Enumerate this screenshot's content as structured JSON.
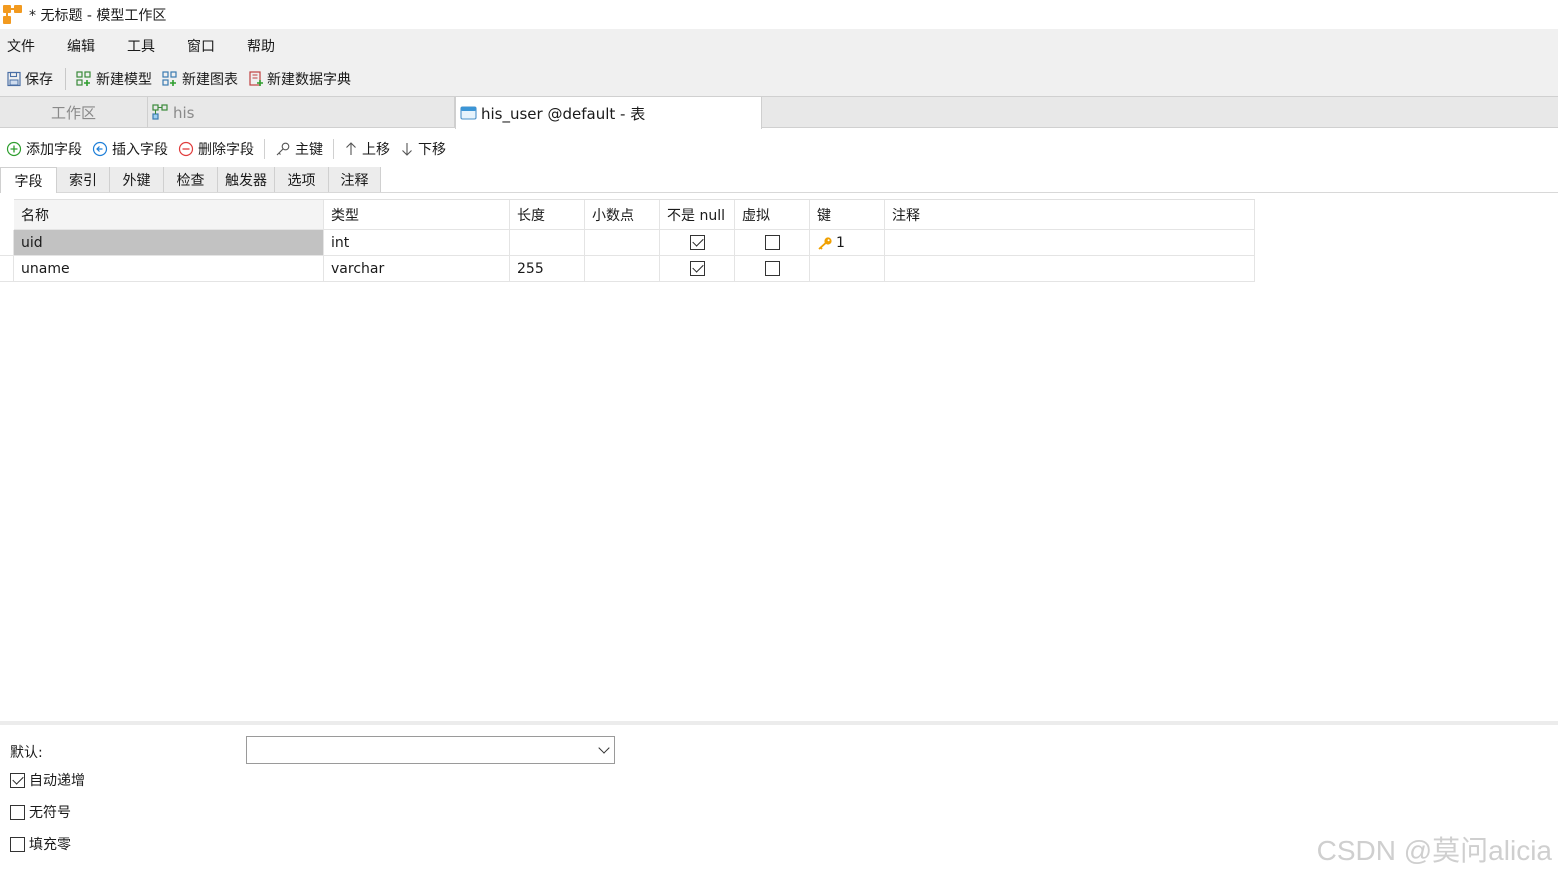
{
  "window": {
    "title": "* 无标题 - 模型工作区"
  },
  "menu": [
    "文件",
    "编辑",
    "工具",
    "窗口",
    "帮助"
  ],
  "toolbar": {
    "save": "保存",
    "new_model": "新建模型",
    "new_diagram": "新建图表",
    "new_dictionary": "新建数据字典"
  },
  "doc_tabs": [
    {
      "label": "工作区"
    },
    {
      "label": "his"
    },
    {
      "label": "his_user @default - 表"
    }
  ],
  "field_toolbar": {
    "add_field": "添加字段",
    "insert_field": "插入字段",
    "delete_field": "删除字段",
    "primary_key": "主键",
    "move_up": "上移",
    "move_down": "下移"
  },
  "sub_tabs": [
    "字段",
    "索引",
    "外键",
    "检查",
    "触发器",
    "选项",
    "注释"
  ],
  "grid": {
    "headers": [
      "名称",
      "类型",
      "长度",
      "小数点",
      "不是 null",
      "虚拟",
      "键",
      "注释"
    ],
    "rows": [
      {
        "name": "uid",
        "type": "int",
        "length": "",
        "decimals": "",
        "not_null": true,
        "virtual": false,
        "key": "1",
        "comment": ""
      },
      {
        "name": "uname",
        "type": "varchar",
        "length": "255",
        "decimals": "",
        "not_null": true,
        "virtual": false,
        "key": "",
        "comment": ""
      }
    ]
  },
  "properties": {
    "default_label": "默认:",
    "default_value": "",
    "auto_increment": {
      "label": "自动递增",
      "checked": true
    },
    "unsigned": {
      "label": "无符号",
      "checked": false
    },
    "zerofill": {
      "label": "填充零",
      "checked": false
    }
  },
  "watermark": "CSDN @莫问alicia",
  "colors": {
    "key_icon": "#f0a000",
    "add": "#2e9e2e",
    "insert": "#1e7fd8",
    "delete": "#e03c3c"
  }
}
